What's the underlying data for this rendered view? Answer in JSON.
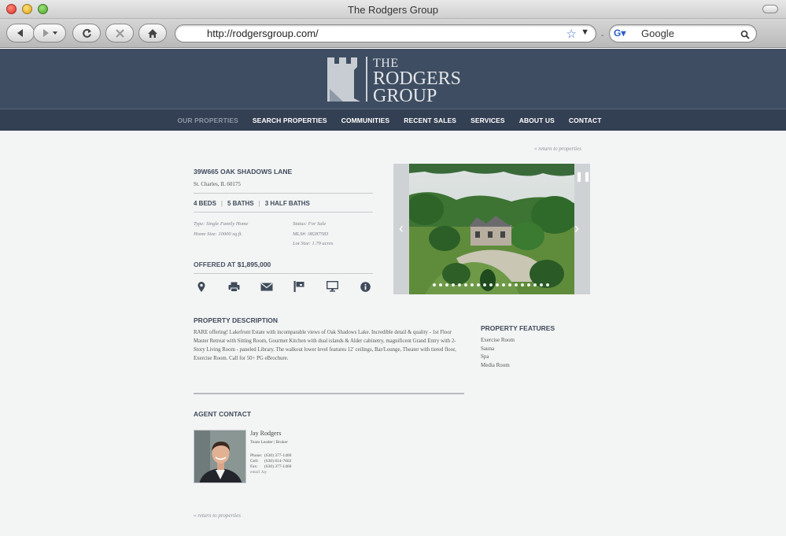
{
  "browser": {
    "window_title": "The Rodgers Group",
    "url": "http://rodgersgroup.com/",
    "search_placeholder": "Google"
  },
  "site": {
    "logo": {
      "the": "THE",
      "rodgers": "RODGERS",
      "group": "GROUP"
    },
    "nav": [
      "OUR PROPERTIES",
      "SEARCH PROPERTIES",
      "COMMUNITIES",
      "RECENT SALES",
      "SERVICES",
      "ABOUT US",
      "CONTACT"
    ],
    "active_nav": "OUR PROPERTIES"
  },
  "listing": {
    "return_link": "« return to properties",
    "title": "39W665 OAK SHADOWS LANE",
    "city": "St. Charles, IL 60175",
    "beds": "4 BEDS",
    "baths": "5 BATHS",
    "half_baths": "3 HALF BATHS",
    "type": "Type: Single Family Home",
    "home_size": "Home Size: 10000 sq.ft.",
    "status": "Status: For Sale",
    "mls": "MLS#: 08287583",
    "lot_size": "Lot Size: 1.79 acres",
    "offered_label": "OFFERED AT",
    "price": "$1,895,000",
    "icons": [
      "map-pin-icon",
      "print-icon",
      "email-icon",
      "flag-icon",
      "monitor-icon",
      "info-icon"
    ]
  },
  "description": {
    "heading": "PROPERTY DESCRIPTION",
    "text": "RARE offering! Lakefront Estate with incomparable views of Oak Shadows Lake. Incredible detail & quality - 1st Floor Master Retreat with Sitting Room, Gourmet Kitchen with dual islands & Alder cabinetry, magnificent Grand Entry with 2-Story Living Room - paneled Library. The walkout lower level features 12' ceilings, Bar/Lounge, Theater with tiered floor, Exercise Room. Call for 50+ PG eBrochure."
  },
  "features": {
    "heading": "PROPERTY FEATURES",
    "items": [
      "Exercise Room",
      "Sauna",
      "Spa",
      "Media Room"
    ]
  },
  "agent": {
    "heading": "AGENT CONTACT",
    "name": "Jay Rodgers",
    "role": "Team Leader | Broker",
    "phone_label": "Phone:",
    "phone": "(630) 377-1400",
    "cell_label": "Cell:",
    "cell": "(630) 814-7602",
    "fax_label": "Fax:",
    "fax": "(630) 377-1460",
    "email": "email Jay"
  },
  "colors": {
    "header_bg": "#3e4d61",
    "nav_bg": "#333f52",
    "page_bg": "#f3f4f4",
    "heading": "#3f4b5b"
  }
}
